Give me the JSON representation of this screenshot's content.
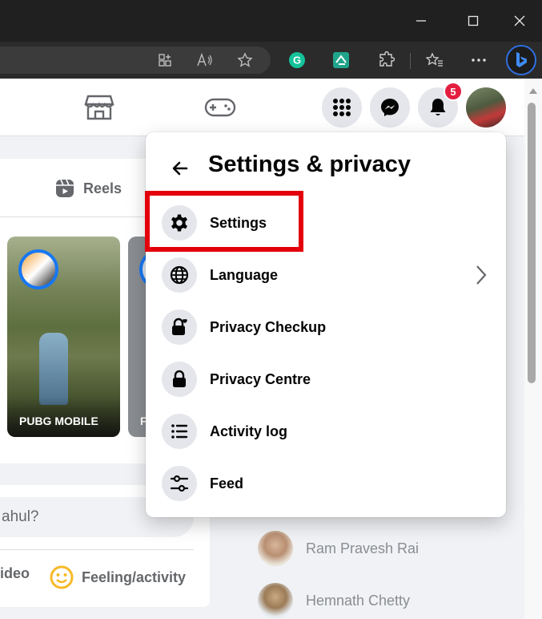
{
  "browser": {
    "window_controls": [
      "minimize-icon",
      "maximize-icon",
      "close-icon"
    ],
    "toolbar_icons": [
      "split-screen-icon",
      "read-aloud-icon",
      "favorite-star-icon",
      "grammarly-icon",
      "extension-icon",
      "extensions-puzzle-icon",
      "favorites-icon",
      "more-icon",
      "bing-icon"
    ]
  },
  "header": {
    "notification_count": "5"
  },
  "feed": {
    "reels_label": "Reels",
    "story_label": "PUBG MOBILE",
    "story2_partial": "F",
    "composer_placeholder": "ahul?",
    "video_partial": "ideo",
    "feeling_label": "Feeling/activity"
  },
  "menu": {
    "title": "Settings & privacy",
    "items": [
      {
        "label": "Settings",
        "icon": "gear-icon"
      },
      {
        "label": "Language",
        "icon": "globe-icon"
      },
      {
        "label": "Privacy Checkup",
        "icon": "lock-heart-icon"
      },
      {
        "label": "Privacy Centre",
        "icon": "lock-icon"
      },
      {
        "label": "Activity log",
        "icon": "list-icon"
      },
      {
        "label": "Feed",
        "icon": "sliders-icon"
      }
    ]
  },
  "contacts": [
    {
      "name": "Ram Pravesh Rai"
    },
    {
      "name": "Hemnath Chetty"
    }
  ],
  "colors": {
    "highlight": "#e3000b",
    "badge": "#e41e3f"
  }
}
